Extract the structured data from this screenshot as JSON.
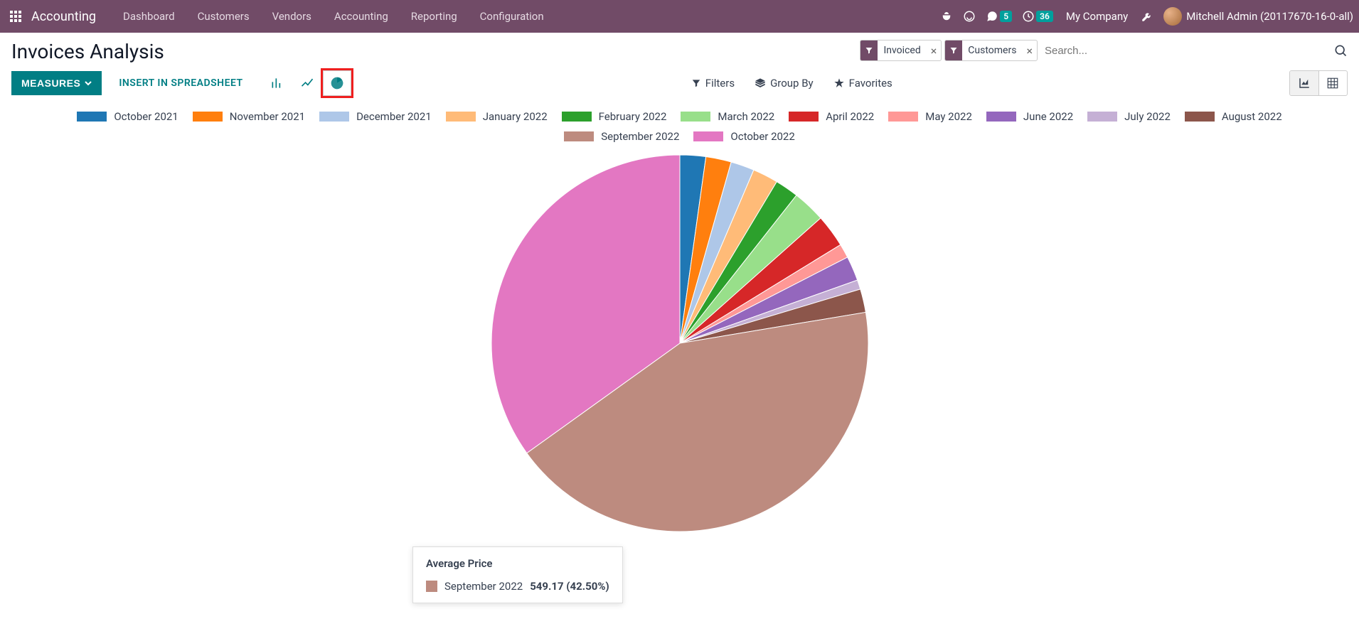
{
  "app": {
    "brand": "Accounting"
  },
  "nav": {
    "items": [
      "Dashboard",
      "Customers",
      "Vendors",
      "Accounting",
      "Reporting",
      "Configuration"
    ],
    "company": "My Company",
    "user": "Mitchell Admin (20117670-16-0-all)",
    "messaging_badge": "5",
    "activities_badge": "36"
  },
  "page": {
    "title": "Invoices Analysis",
    "measures_label": "MEASURES",
    "insert_label": "INSERT IN SPREADSHEET"
  },
  "search": {
    "facets": [
      {
        "label": "Invoiced"
      },
      {
        "label": "Customers"
      }
    ],
    "placeholder": "Search..."
  },
  "controls": {
    "filters": "Filters",
    "groupby": "Group By",
    "favorites": "Favorites"
  },
  "tooltip": {
    "title": "Average Price",
    "slice_label": "September 2022",
    "value": "549.17 (42.50%)",
    "color": "#bd8b7f"
  },
  "chart_data": {
    "type": "pie",
    "title": "Average Price",
    "series": [
      {
        "name": "October 2021",
        "color": "#1f77b4",
        "value": 28.5,
        "pct": 2.2
      },
      {
        "name": "November 2021",
        "color": "#ff7f0e",
        "value": 28.0,
        "pct": 2.17
      },
      {
        "name": "December 2021",
        "color": "#aec7e8",
        "value": 26.0,
        "pct": 2.01
      },
      {
        "name": "January 2022",
        "color": "#ffbb78",
        "value": 28.0,
        "pct": 2.17
      },
      {
        "name": "February 2022",
        "color": "#2ca02c",
        "value": 26.0,
        "pct": 2.01
      },
      {
        "name": "March 2022",
        "color": "#98df8a",
        "value": 36.2,
        "pct": 2.8
      },
      {
        "name": "April 2022",
        "color": "#d62728",
        "value": 36.2,
        "pct": 2.8
      },
      {
        "name": "May 2022",
        "color": "#ff9896",
        "value": 15.5,
        "pct": 1.2
      },
      {
        "name": "June 2022",
        "color": "#9467bd",
        "value": 27.1,
        "pct": 2.1
      },
      {
        "name": "July 2022",
        "color": "#c5b0d5",
        "value": 10.3,
        "pct": 0.8
      },
      {
        "name": "August 2022",
        "color": "#8c564b",
        "value": 25.8,
        "pct": 2.0
      },
      {
        "name": "September 2022",
        "color": "#bd8b7f",
        "value": 549.17,
        "pct": 42.5
      },
      {
        "name": "October 2022",
        "color": "#e377c2",
        "value": 455.0,
        "pct": 34.74
      }
    ]
  }
}
